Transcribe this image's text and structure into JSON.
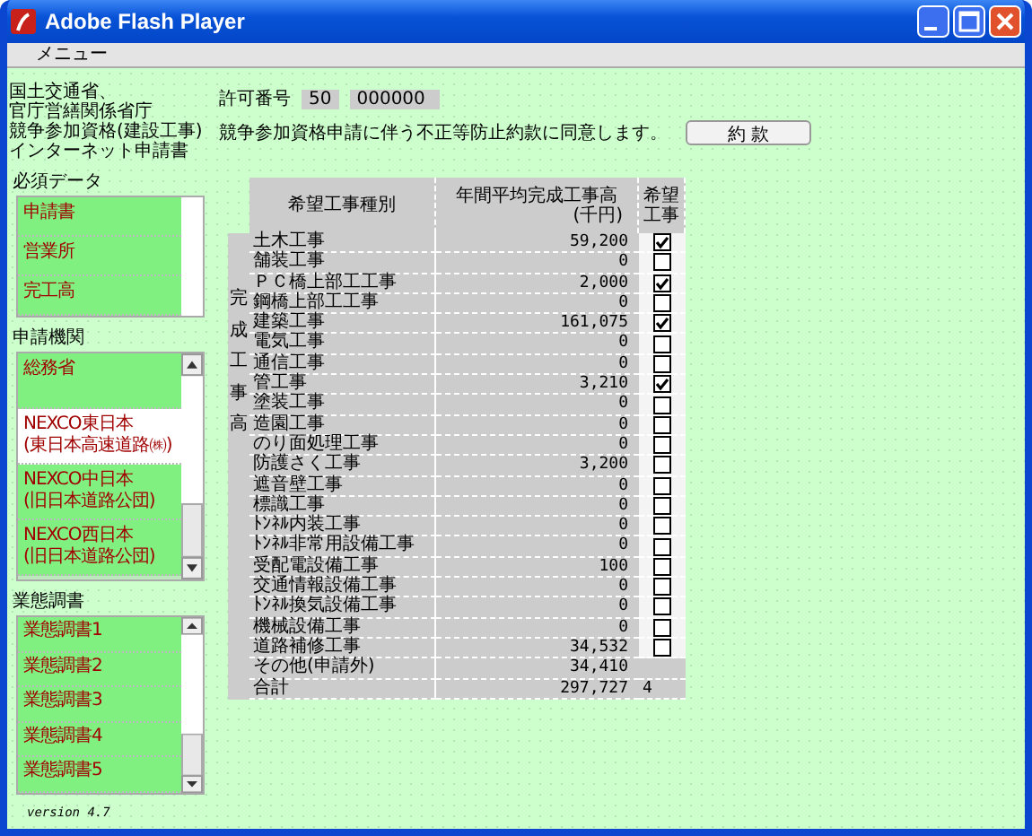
{
  "window": {
    "title": "Adobe Flash Player"
  },
  "menu": [
    "メニュー"
  ],
  "header_lines": [
    "国土交通省、",
    "官庁営繕関係省庁",
    "競争参加資格(建設工事)",
    "インターネット申請書"
  ],
  "permit": {
    "label": "許可番号",
    "fields": [
      "50",
      "000000"
    ]
  },
  "agreement": {
    "text": "競争参加資格申請に伴う不正等防止約款に同意します。",
    "button": "約 款"
  },
  "panels": [
    {
      "title": "必須データ",
      "kind": "plain",
      "items": [
        {
          "lines": [
            "申請書"
          ],
          "selected": false
        },
        {
          "lines": [
            "営業所"
          ],
          "selected": false
        },
        {
          "lines": [
            "完工高"
          ],
          "selected": false
        }
      ]
    },
    {
      "title": "申請機関",
      "kind": "arrows",
      "items": [
        {
          "lines": [
            "総務省"
          ],
          "selected": false
        },
        {
          "lines": [
            "NEXCO東日本",
            "(東日本高速道路㈱)"
          ],
          "selected": true
        },
        {
          "lines": [
            "NEXCO中日本",
            "(旧日本道路公団)"
          ],
          "selected": false
        },
        {
          "lines": [
            "NEXCO西日本",
            "(旧日本道路公団)"
          ],
          "selected": false
        }
      ]
    },
    {
      "title": "業態調書",
      "kind": "arrows",
      "items": [
        {
          "lines": [
            "業態調書1"
          ],
          "selected": false
        },
        {
          "lines": [
            "業態調書2"
          ],
          "selected": false
        },
        {
          "lines": [
            "業態調書3"
          ],
          "selected": false
        },
        {
          "lines": [
            "業態調書4"
          ],
          "selected": false
        },
        {
          "lines": [
            "業態調書5"
          ],
          "selected": false
        }
      ]
    }
  ],
  "version": "version 4.7",
  "table": {
    "columns": [
      {
        "lines": [
          "希望工事種別"
        ]
      },
      {
        "lines": [
          "年間平均完成工事高",
          "(千円)"
        ]
      },
      {
        "lines": [
          "希望",
          "工事"
        ]
      }
    ],
    "side_label": "完成工事高",
    "rows": [
      {
        "name": "土木工事",
        "amount": "59,200",
        "checked": true
      },
      {
        "name": "舗装工事",
        "amount": "0",
        "checked": false
      },
      {
        "name": "ＰＣ橋上部工工事",
        "amount": "2,000",
        "checked": true
      },
      {
        "name": "鋼橋上部工工事",
        "amount": "0",
        "checked": false
      },
      {
        "name": "建築工事",
        "amount": "161,075",
        "checked": true
      },
      {
        "name": "電気工事",
        "amount": "0",
        "checked": false
      },
      {
        "name": "通信工事",
        "amount": "0",
        "checked": false
      },
      {
        "name": "管工事",
        "amount": "3,210",
        "checked": true
      },
      {
        "name": "塗装工事",
        "amount": "0",
        "checked": false
      },
      {
        "name": "造園工事",
        "amount": "0",
        "checked": false
      },
      {
        "name": "のり面処理工事",
        "amount": "0",
        "checked": false
      },
      {
        "name": "防護さく工事",
        "amount": "3,200",
        "checked": false
      },
      {
        "name": "遮音壁工事",
        "amount": "0",
        "checked": false
      },
      {
        "name": "標識工事",
        "amount": "0",
        "checked": false
      },
      {
        "name": "ﾄﾝﾈﾙ内装工事",
        "amount": "0",
        "checked": false
      },
      {
        "name": "ﾄﾝﾈﾙ非常用設備工事",
        "amount": "0",
        "checked": false
      },
      {
        "name": "受配電設備工事",
        "amount": "100",
        "checked": false
      },
      {
        "name": "交通情報設備工事",
        "amount": "0",
        "checked": false
      },
      {
        "name": "ﾄﾝﾈﾙ換気設備工事",
        "amount": "0",
        "checked": false
      },
      {
        "name": "機械設備工事",
        "amount": "0",
        "checked": false
      },
      {
        "name": "道路補修工事",
        "amount": "34,532",
        "checked": false
      }
    ],
    "other": {
      "name": "その他(申請外)",
      "amount": "34,410"
    },
    "total": {
      "name": "合計",
      "amount": "297,727",
      "count": "4"
    }
  }
}
